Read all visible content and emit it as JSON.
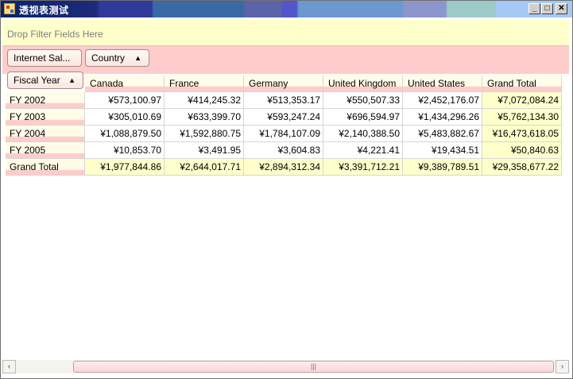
{
  "window": {
    "title": "透视表测试",
    "buttons": {
      "minimize": "_",
      "maximize": "□",
      "close": "✕"
    }
  },
  "filter_area": {
    "placeholder": "Drop Filter Fields Here"
  },
  "data_fields": [
    {
      "label": "Internet Sal..."
    }
  ],
  "column_fields": [
    {
      "label": "Country",
      "sort_icon": "▲"
    }
  ],
  "row_fields": [
    {
      "label": "Fiscal Year",
      "sort_icon": "▲"
    }
  ],
  "table": {
    "columns": [
      "Canada",
      "France",
      "Germany",
      "United Kingdom",
      "United States",
      "Grand Total"
    ],
    "rows": [
      {
        "label": "FY 2002",
        "values": [
          "¥573,100.97",
          "¥414,245.32",
          "¥513,353.17",
          "¥550,507.33",
          "¥2,452,176.07",
          "¥7,072,084.24"
        ]
      },
      {
        "label": "FY 2003",
        "values": [
          "¥305,010.69",
          "¥633,399.70",
          "¥593,247.24",
          "¥696,594.97",
          "¥1,434,296.26",
          "¥5,762,134.30"
        ]
      },
      {
        "label": "FY 2004",
        "values": [
          "¥1,088,879.50",
          "¥1,592,880.75",
          "¥1,784,107.09",
          "¥2,140,388.50",
          "¥5,483,882.67",
          "¥16,473,618.05"
        ]
      },
      {
        "label": "FY 2005",
        "values": [
          "¥10,853.70",
          "¥3,491.95",
          "¥3,604.83",
          "¥4,221.41",
          "¥19,434.51",
          "¥50,840.63"
        ]
      },
      {
        "label": "Grand Total",
        "values": [
          "¥1,977,844.86",
          "¥2,644,017.71",
          "¥2,894,312.34",
          "¥3,391,712.21",
          "¥9,389,789.51",
          "¥29,358,677.22"
        ]
      }
    ]
  },
  "scrollbar": {
    "left_arrow": "‹",
    "right_arrow": "›",
    "grip": "|||"
  }
}
